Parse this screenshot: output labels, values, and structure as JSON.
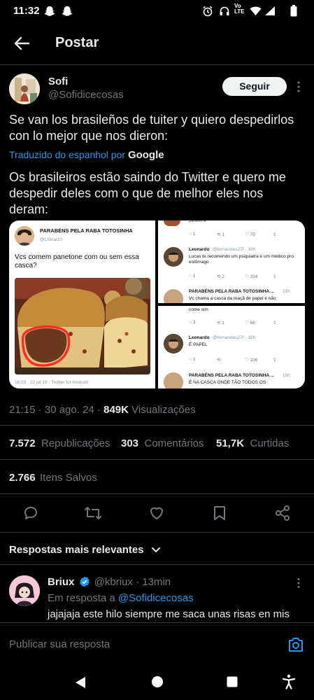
{
  "status_bar": {
    "time": "11:32",
    "network": "LTE"
  },
  "header": {
    "title": "Postar"
  },
  "tweet": {
    "author_name": "Sofi",
    "author_handle": "@Sofidicecosas",
    "follow_label": "Seguir",
    "original_text": "Se van los brasileños de tuiter y quiero despedirlos con lo mejor que nos dieron:",
    "translated_by": "Traduzido do espanhol por",
    "translator": "Google",
    "translated_text": "Os brasileiros estão saindo do Twitter e quero me despedir deles com o que de melhor eles nos deram:",
    "timestamp": "21:15 · 30 ago. 24 ·",
    "views_count": "849K",
    "views_label": "Visualizações",
    "reposts_count": "7.572",
    "reposts_label": "Republicações",
    "comments_count": "303",
    "comments_label": "Comentários",
    "likes_count": "51,7K",
    "likes_label": "Curtidas",
    "saves_count": "2.766",
    "saves_label": "Itens Salvos"
  },
  "media": {
    "left": {
      "header": "PARABÉNS PELA RABA TOTOSINHA",
      "handle": "@LSinal10",
      "text": "Vcs comem panetone com ou sem essa casca?",
      "footer": "16:03 · 22 jul 19 · Twitter for Android"
    },
    "top_right": {
      "top_snippet": "panetone",
      "row1": [
        "1",
        "1",
        "75"
      ],
      "reply_name": "Leonardo",
      "reply_meta": "@fernandes27f · 19h",
      "reply_text": "Lucas te recomendo um psiquiatra e um medico pro estômago",
      "row2": [
        "1",
        "2",
        "334"
      ],
      "bottom_name": "PARABÉNS PELA RABA TOTOSINHA ...",
      "bottom_meta": "19h",
      "bottom_text": "Vc chama a casca da maçã de papel e não"
    },
    "bottom_right": {
      "top_snippet": "come sim",
      "row1": [
        "3",
        "1",
        "86"
      ],
      "reply_name": "Leonardo",
      "reply_meta": "@fernandes27f · 19h",
      "reply_text": "É PAPEL",
      "row2": [
        "1",
        "",
        "106"
      ],
      "bottom_name": "PARABÉNS PELA RABA TOTOSINHA ...",
      "bottom_meta": "18h",
      "bottom_text": "É NA CASCA ONDE TÃO TODOS OS"
    }
  },
  "replies_section": {
    "title": "Respostas mais relevantes"
  },
  "reply": {
    "name": "Briux",
    "handle": "@kbriux",
    "time": "· 13min",
    "in_reply_prefix": "Em resposta a",
    "in_reply_handle": "@Sofidicecosas",
    "text": "jajajaja este hilo siempre me saca unas risas en mis"
  },
  "composer": {
    "placeholder": "Publicar sua resposta"
  },
  "colors": {
    "accent": "#1d9bf0",
    "verified": "#1d9bf0",
    "background": "#000000",
    "muted": "#71767b"
  }
}
